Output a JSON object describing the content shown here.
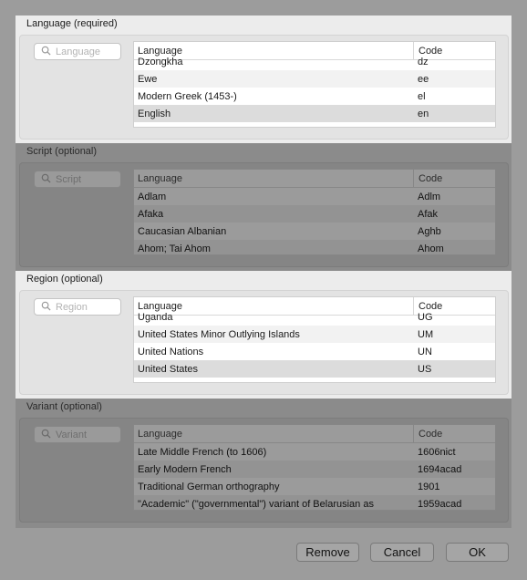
{
  "sections": [
    {
      "title": "Language (required)",
      "search_placeholder": "Language",
      "columns": {
        "language": "Language",
        "code": "Code"
      },
      "rows": [
        {
          "language": "Dzongkha",
          "code": "dz"
        },
        {
          "language": "Ewe",
          "code": "ee"
        },
        {
          "language": "Modern Greek (1453-)",
          "code": "el"
        },
        {
          "language": "English",
          "code": "en"
        }
      ]
    },
    {
      "title": "Script (optional)",
      "search_placeholder": "Script",
      "columns": {
        "language": "Language",
        "code": "Code"
      },
      "rows": [
        {
          "language": "Adlam",
          "code": "Adlm"
        },
        {
          "language": "Afaka",
          "code": "Afak"
        },
        {
          "language": "Caucasian Albanian",
          "code": "Aghb"
        },
        {
          "language": "Ahom; Tai Ahom",
          "code": "Ahom"
        }
      ]
    },
    {
      "title": "Region (optional)",
      "search_placeholder": "Region",
      "columns": {
        "language": "Language",
        "code": "Code"
      },
      "rows": [
        {
          "language": "Uganda",
          "code": "UG"
        },
        {
          "language": "United States Minor Outlying Islands",
          "code": "UM"
        },
        {
          "language": "United Nations",
          "code": "UN"
        },
        {
          "language": "United States",
          "code": "US"
        }
      ]
    },
    {
      "title": "Variant (optional)",
      "search_placeholder": "Variant",
      "columns": {
        "language": "Language",
        "code": "Code"
      },
      "rows": [
        {
          "language": "Late Middle French (to 1606)",
          "code": "1606nict"
        },
        {
          "language": "Early Modern French",
          "code": "1694acad"
        },
        {
          "language": "Traditional German orthography",
          "code": "1901"
        },
        {
          "language": "\"Academic\" (\"governmental\") variant of Belarusian as",
          "code": "1959acad"
        }
      ]
    }
  ],
  "buttons": {
    "remove": "Remove",
    "cancel": "Cancel",
    "ok": "OK"
  },
  "icons": {
    "search": "search-icon"
  }
}
